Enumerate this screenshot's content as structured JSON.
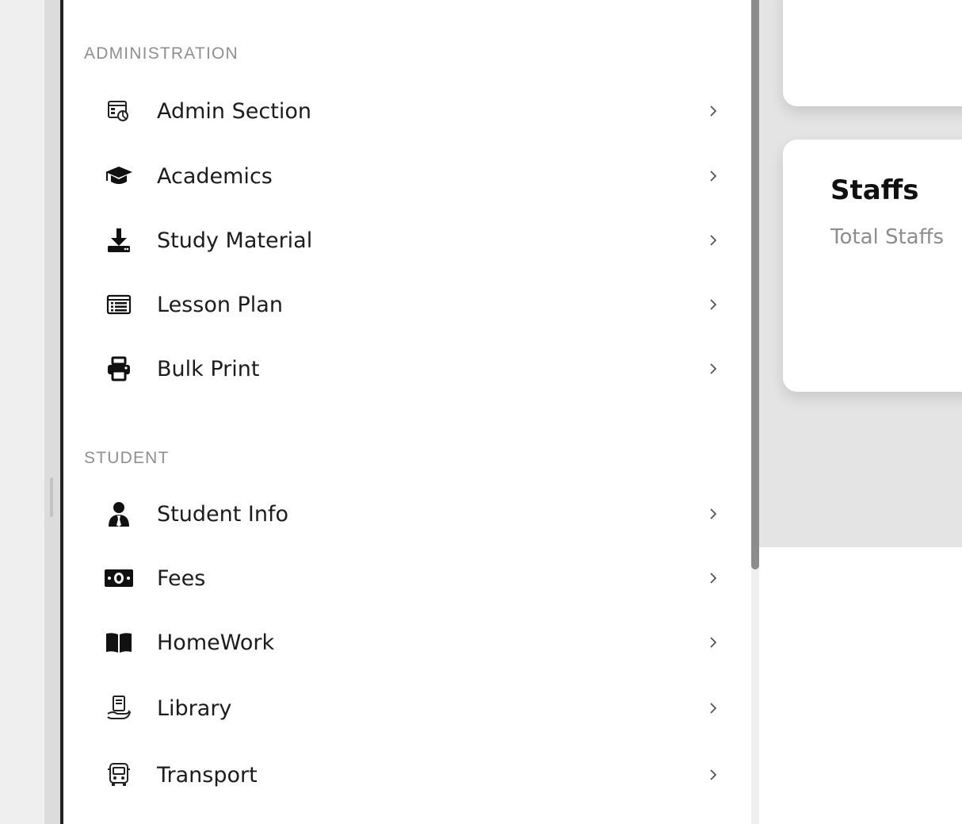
{
  "drawer": {
    "sections": [
      {
        "title": "ADMINISTRATION",
        "items": [
          {
            "label": "Admin Section",
            "icon": "admin-dashboard-icon"
          },
          {
            "label": "Academics",
            "icon": "graduation-cap-icon"
          },
          {
            "label": "Study Material",
            "icon": "download-icon"
          },
          {
            "label": "Lesson Plan",
            "icon": "list-icon"
          },
          {
            "label": "Bulk Print",
            "icon": "printer-icon"
          }
        ]
      },
      {
        "title": "STUDENT",
        "items": [
          {
            "label": "Student Info",
            "icon": "user-icon"
          },
          {
            "label": "Fees",
            "icon": "money-icon"
          },
          {
            "label": "HomeWork",
            "icon": "book-icon"
          },
          {
            "label": "Library",
            "icon": "library-icon"
          },
          {
            "label": "Transport",
            "icon": "bus-icon"
          }
        ]
      }
    ]
  },
  "cards": {
    "staffs": {
      "title": "Staffs",
      "subtitle": "Total Staffs"
    }
  },
  "colors": {
    "section_title": "#8f8f8f",
    "item_text": "#1c1c1c",
    "scroll_thumb": "#8c8c8c"
  }
}
